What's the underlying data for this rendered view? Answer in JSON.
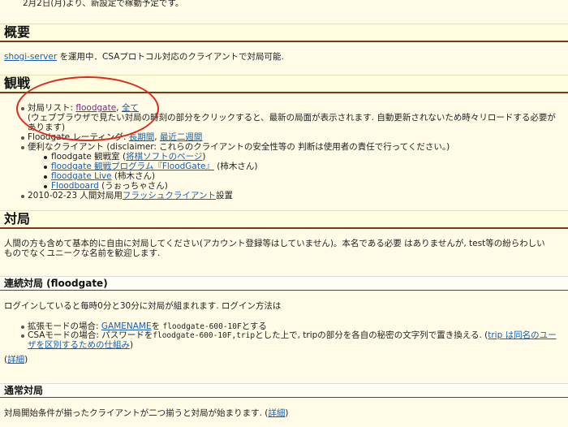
{
  "top_note": "2月2日(月)より、新設定で稼動予定です。",
  "sections": {
    "overview": {
      "heading": "概要",
      "link": "shogi-server",
      "text": " を運用中．CSAプロトコル対応のクライアントで対局可能."
    },
    "watching": {
      "heading": "観戦",
      "item1_prefix": "対局リスト: ",
      "item1_link1": "floodgate",
      "item1_sep": ", ",
      "item1_link2": "全て",
      "item1_desc_line1": "(ウェブブラウザで見たい対局の時刻の部分をクリックすると、最新の局面が表示されます. 自動更新されないため時々リロードする必要が",
      "item1_desc_line2": "あります)",
      "item2_prefix": "Floodgate レーティング: ",
      "item2_link1": "長期間",
      "item2_sep": ", ",
      "item2_link2": "最近二週間",
      "item3_text": "便利なクライアント (disclaimer: これらのクライアントの安全性等の 判断は使用者の責任で行ってください。)",
      "sub1_text": "floodgate 観戦室 (",
      "sub1_link": "将棋ソフトのページ",
      "sub1_end": ")",
      "sub2_link": "floodgate 観戦プログラム『FloodGate』",
      "sub2_end": " (柿木さん)",
      "sub3_link": "floodgate Live",
      "sub3_end": " (柿木さん)",
      "sub4_link": "Floodboard",
      "sub4_end": " (うぉっちゃさん)",
      "item4_prefix": "2010-02-23 人間対局用",
      "item4_link": "フラッシュクライアント",
      "item4_end": "設置"
    },
    "match": {
      "heading": "対局",
      "para_line1": "人間の方も含めて基本的に自由に対局してください(アカウント登録等はしていません)。本名である必要 はありませんが, test等の紛らわしい",
      "para_line2": "ものでなくユニークな名前を歓迎します."
    },
    "continuous": {
      "heading": "連続対局 (floodgate)",
      "intro": "ログインしていると毎時0分と30分に対局が組まれます. ログイン方法は",
      "li1_prefix": "拡張モードの場合: ",
      "li1_link": "GAMENAME",
      "li1_mid": "を ",
      "li1_code": "floodgate-600-10F",
      "li1_end": "とする",
      "li2_prefix": "CSAモードの場合: パスワードを",
      "li2_code": "floodgate-600-10F,trip",
      "li2_mid": "とした上で, tripの部分を各自の秘密の文字列で置き換える. (",
      "li2_link_line1": "trip は同名のユー",
      "li2_link_line2": "ザを区別するための仕組み",
      "li2_end": ")",
      "detail_open": "(",
      "detail_link": "詳細",
      "detail_close": ")"
    },
    "normal": {
      "heading": "通常対局",
      "text_prefix": "対局開始条件が揃ったクライアントが二つ揃うと対局が始まります. (",
      "detail_link": "詳細",
      "text_end": ")"
    }
  },
  "colors": {
    "background": "#fffbe6",
    "heading_rule": "#7a3b12",
    "link": "#1a5fa8",
    "visited_link": "#7a2a7a",
    "annotation_circle": "#e0261d"
  }
}
